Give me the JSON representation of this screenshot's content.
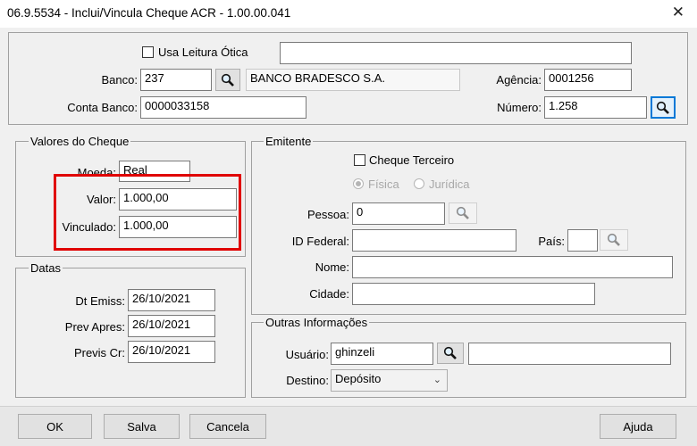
{
  "window": {
    "title": "06.9.5534 - Inclui/Vincula Cheque ACR - 1.00.00.041",
    "close_glyph": "✕"
  },
  "header": {
    "usa_leitura_label": "Usa Leitura Ótica",
    "usa_leitura_checked": false,
    "leitura_value": "",
    "banco_label": "Banco:",
    "banco_code": "237",
    "banco_name": "BANCO BRADESCO S.A.",
    "agencia_label": "Agência:",
    "agencia_value": "0001256",
    "conta_label": "Conta Banco:",
    "conta_value": "0000033158",
    "numero_label": "Número:",
    "numero_value": "1.258"
  },
  "valores": {
    "legend": "Valores do Cheque",
    "moeda_label": "Moeda:",
    "moeda_value": "Real",
    "valor_label": "Valor:",
    "valor_value": "1.000,00",
    "vinculado_label": "Vinculado:",
    "vinculado_value": "1.000,00"
  },
  "datas": {
    "legend": "Datas",
    "emiss_label": "Dt Emiss:",
    "emiss_value": "26/10/2021",
    "prev_apres_label": "Prev Apres:",
    "prev_apres_value": "26/10/2021",
    "previs_cr_label": "Previs Cr:",
    "previs_cr_value": "26/10/2021"
  },
  "emitente": {
    "legend": "Emitente",
    "terceiro_label": "Cheque Terceiro",
    "terceiro_checked": false,
    "fisica_label": "Física",
    "juridica_label": "Jurídica",
    "pessoa_label": "Pessoa:",
    "pessoa_value": "0",
    "id_federal_label": "ID Federal:",
    "id_federal_value": "",
    "pais_label": "País:",
    "pais_value": "",
    "nome_label": "Nome:",
    "nome_value": "",
    "cidade_label": "Cidade:",
    "cidade_value": ""
  },
  "outras": {
    "legend": "Outras Informações",
    "usuario_label": "Usuário:",
    "usuario_value": "ghinzeli",
    "usuario_name": "",
    "destino_label": "Destino:",
    "destino_value": "Depósito"
  },
  "buttons": {
    "ok": "OK",
    "salva": "Salva",
    "cancela": "Cancela",
    "ajuda": "Ajuda"
  },
  "icons": {
    "lookup": "magnifier-icon",
    "dropdown": "chevron-down-icon"
  },
  "colors": {
    "highlight": "#e00000",
    "focus": "#0078d7"
  }
}
